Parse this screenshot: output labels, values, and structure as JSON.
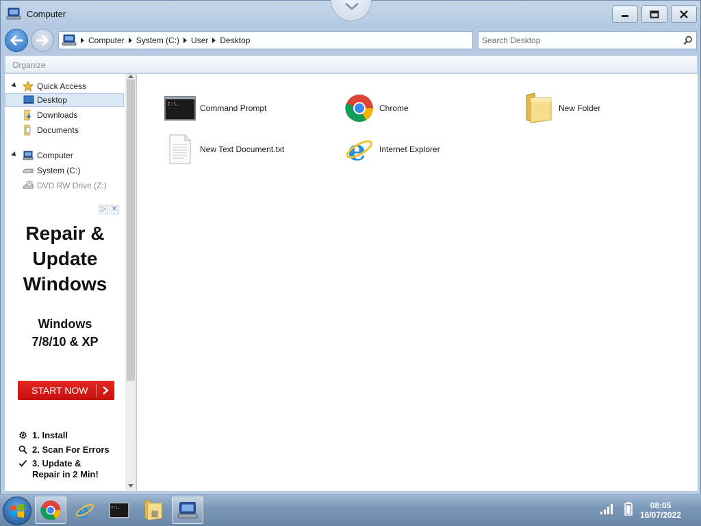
{
  "window": {
    "title": "Computer"
  },
  "address": {
    "crumbs": [
      "Computer",
      "System (C:)",
      "User",
      "Desktop"
    ]
  },
  "search": {
    "placeholder": "Search Desktop"
  },
  "toolbar": {
    "organize_label": "Organize"
  },
  "navpane": {
    "quick_access": "Quick Access",
    "desktop": "Desktop",
    "downloads": "Downloads",
    "documents": "Documents",
    "computer": "Computer",
    "system_c": "System (C:)",
    "dvd_drive": "DVD RW Drive (Z:)"
  },
  "ad": {
    "headline_1": "Repair &",
    "headline_2": "Update",
    "headline_3": "Windows",
    "sub_1": "Windows",
    "sub_2": "7/8/10 & XP",
    "cta": "START NOW",
    "step_1": "1. Install",
    "step_2": "2. Scan For Errors",
    "step_3a": "3. Update &",
    "step_3b": "Repair in 2 Min!"
  },
  "files": [
    {
      "name": "Command Prompt",
      "icon": "command-prompt-icon"
    },
    {
      "name": "Chrome",
      "icon": "chrome-icon"
    },
    {
      "name": "New Folder",
      "icon": "folder-icon"
    },
    {
      "name": "New Text Document.txt",
      "icon": "text-document-icon"
    },
    {
      "name": "Internet Explorer",
      "icon": "internet-explorer-icon"
    }
  ],
  "taskbar": {
    "time": "08:05",
    "date": "16/07/2022"
  },
  "colors": {
    "title_bar": "#b9cde3",
    "selection": "#dbe9f7",
    "ad_cta": "#d81e1a",
    "taskbar": "#7b98b8"
  }
}
